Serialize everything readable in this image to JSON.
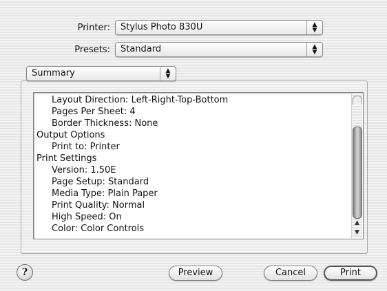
{
  "printer": {
    "label": "Printer:",
    "value": "Stylus Photo 830U"
  },
  "presets": {
    "label": "Presets:",
    "value": "Standard"
  },
  "panel_select": {
    "value": "Summary"
  },
  "summary_lines": [
    {
      "text": "Layout Direction:  Left-Right-Top-Bottom",
      "indent": 1
    },
    {
      "text": "Pages Per Sheet:  4",
      "indent": 1
    },
    {
      "text": "Border Thickness:  None",
      "indent": 1
    },
    {
      "text": "Output Options",
      "indent": 0
    },
    {
      "text": "Print to:  Printer",
      "indent": 1
    },
    {
      "text": "Print Settings",
      "indent": 0
    },
    {
      "text": "Version:  1.50E",
      "indent": 1
    },
    {
      "text": "Page Setup:  Standard",
      "indent": 1
    },
    {
      "text": "Media Type:  Plain Paper",
      "indent": 1
    },
    {
      "text": "Print Quality:  Normal",
      "indent": 1
    },
    {
      "text": "High Speed:  On",
      "indent": 1
    },
    {
      "text": "Color:  Color Controls",
      "indent": 1
    }
  ],
  "buttons": {
    "help": "?",
    "preview": "Preview",
    "cancel": "Cancel",
    "print": "Print"
  },
  "icons": {
    "popup_arrows": "up-down-arrows-icon",
    "scroll_up": "scroll-up-arrow-icon",
    "scroll_down": "scroll-down-arrow-icon",
    "help": "help-icon"
  }
}
